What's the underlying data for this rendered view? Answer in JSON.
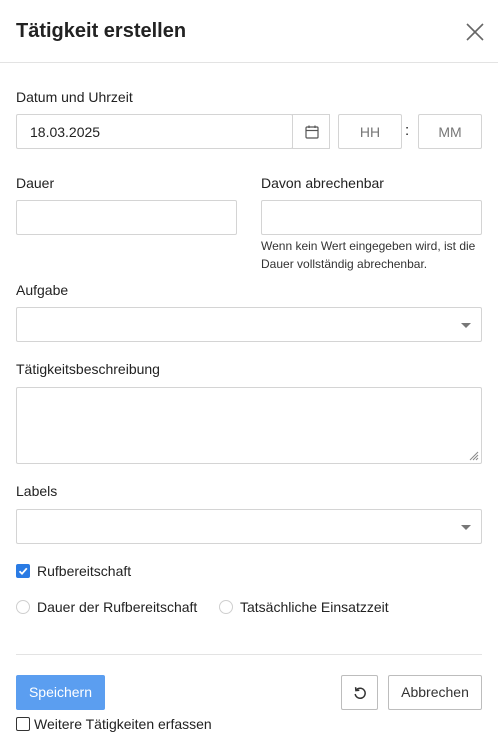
{
  "dialog": {
    "title": "Tätigkeit erstellen",
    "close_icon": "close-icon"
  },
  "datetime": {
    "label": "Datum und Uhrzeit",
    "date_value": "18.03.2025",
    "calendar_icon": "calendar-icon",
    "hour_placeholder": "HH",
    "minute_placeholder": "MM",
    "separator": ":"
  },
  "duration": {
    "label": "Dauer",
    "value": ""
  },
  "billable": {
    "label": "Davon abrechenbar",
    "value": "",
    "hint": "Wenn kein Wert eingegeben wird, ist die Dauer vollständig abrechenbar."
  },
  "task": {
    "label": "Aufgabe",
    "selected": ""
  },
  "description": {
    "label": "Tätigkeitsbeschreibung",
    "value": ""
  },
  "labels": {
    "label": "Labels",
    "selected": ""
  },
  "on_call": {
    "label": "Rufbereitschaft",
    "checked": true,
    "options": [
      {
        "label": "Dauer der Rufbereitschaft",
        "selected": false
      },
      {
        "label": "Tatsächliche Einsatzzeit",
        "selected": false
      }
    ]
  },
  "footer": {
    "save_label": "Speichern",
    "reset_icon": "reset-icon",
    "cancel_label": "Abbrechen",
    "more_label": "Weitere Tätigkeiten erfassen",
    "more_checked": false
  },
  "colors": {
    "primary": "#5b9ef0",
    "checkbox": "#2a7be4",
    "border": "#d4d4d4"
  }
}
